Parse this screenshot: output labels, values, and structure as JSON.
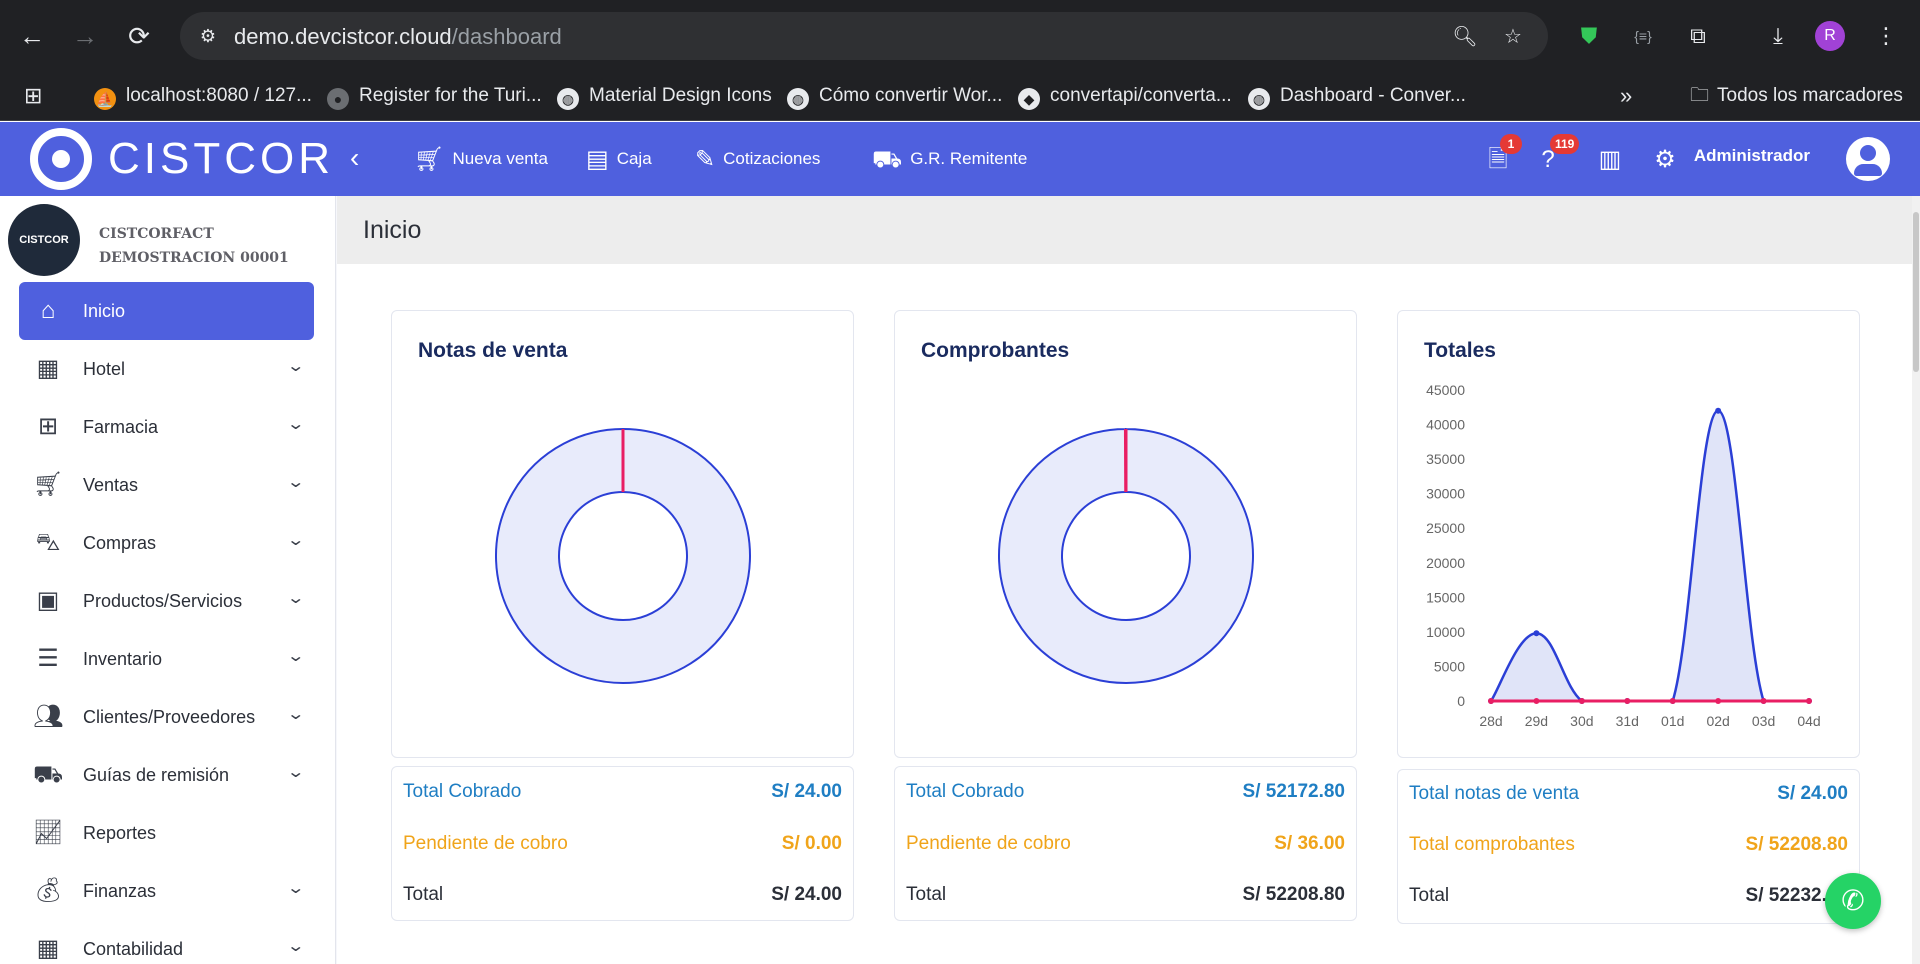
{
  "browser": {
    "url_domain": "demo.devcistcor.cloud",
    "url_path": "/dashboard",
    "profile_initial": "R",
    "bookmarks": [
      "localhost:8080 / 127...",
      "Register for the Turi...",
      "Material Design Icons",
      "Cómo convertir Wor...",
      "convertapi/converta...",
      "Dashboard - Conver..."
    ],
    "all_bookmarks_label": "Todos los marcadores"
  },
  "brand": {
    "name": "CISTCOR"
  },
  "topbar": {
    "items": [
      "Nueva venta",
      "Caja",
      "Cotizaciones",
      "G.R. Remitente"
    ],
    "badge_docs": "1",
    "badge_help": "119",
    "user_name": "Administrador"
  },
  "company": {
    "logo_text": "CISTCOR",
    "line1": "CISTCORFACT",
    "line2": "DEMOSTRACION 00001"
  },
  "sidebar": {
    "items": [
      {
        "label": "Inicio",
        "icon": "home-icon",
        "active": true,
        "expandable": false
      },
      {
        "label": "Hotel",
        "icon": "hotel-icon",
        "active": false,
        "expandable": true
      },
      {
        "label": "Farmacia",
        "icon": "pharmacy-icon",
        "active": false,
        "expandable": true
      },
      {
        "label": "Ventas",
        "icon": "cart-plus-icon",
        "active": false,
        "expandable": true
      },
      {
        "label": "Compras",
        "icon": "dolly-icon",
        "active": false,
        "expandable": true
      },
      {
        "label": "Productos/Servicios",
        "icon": "boxes-icon",
        "active": false,
        "expandable": true
      },
      {
        "label": "Inventario",
        "icon": "checklist-icon",
        "active": false,
        "expandable": true
      },
      {
        "label": "Clientes/Proveedores",
        "icon": "users-icon",
        "active": false,
        "expandable": true
      },
      {
        "label": "Guías de remisión",
        "icon": "truck-icon",
        "active": false,
        "expandable": true
      },
      {
        "label": "Reportes",
        "icon": "chart-line-icon",
        "active": false,
        "expandable": false
      },
      {
        "label": "Finanzas",
        "icon": "money-bag-icon",
        "active": false,
        "expandable": true
      },
      {
        "label": "Contabilidad",
        "icon": "calculator-icon",
        "active": false,
        "expandable": true
      }
    ]
  },
  "page": {
    "title": "Inicio"
  },
  "cards": {
    "notas": {
      "title": "Notas de venta",
      "rows": [
        {
          "label": "Total Cobrado",
          "value": "S/ 24.00"
        },
        {
          "label": "Pendiente de cobro",
          "value": "S/ 0.00"
        },
        {
          "label": "Total",
          "value": "S/ 24.00"
        }
      ]
    },
    "comprobantes": {
      "title": "Comprobantes",
      "rows": [
        {
          "label": "Total Cobrado",
          "value": "S/ 52172.80"
        },
        {
          "label": "Pendiente de cobro",
          "value": "S/ 36.00"
        },
        {
          "label": "Total",
          "value": "S/ 52208.80"
        }
      ]
    },
    "totales": {
      "title": "Totales",
      "rows": [
        {
          "label": "Total notas de venta",
          "value": "S/ 24.00"
        },
        {
          "label": "Total comprobantes",
          "value": "S/ 52208.80"
        },
        {
          "label": "Total",
          "value": "S/ 52232.80"
        }
      ]
    }
  },
  "chart_data": [
    {
      "type": "pie",
      "variant": "doughnut",
      "labels": [
        "Total Cobrado",
        "Pendiente de cobro"
      ],
      "values": [
        24.0,
        0.0
      ],
      "colors": [
        "#e8ebfb",
        "#e91e63"
      ],
      "border": "#2b3fd6"
    },
    {
      "type": "pie",
      "variant": "doughnut",
      "labels": [
        "Total Cobrado",
        "Pendiente de cobro"
      ],
      "values": [
        52172.8,
        36.0
      ],
      "colors": [
        "#e8ebfb",
        "#e91e63"
      ],
      "border": "#2b3fd6"
    },
    {
      "type": "area",
      "x": [
        "28d",
        "29d",
        "30d",
        "31d",
        "01d",
        "02d",
        "03d",
        "04d"
      ],
      "series": [
        {
          "values": [
            0,
            9800,
            0,
            0,
            0,
            42000,
            0,
            0
          ],
          "color": "#2b3fd6",
          "fill": "#e0e4f8"
        },
        {
          "values": [
            0,
            0,
            0,
            0,
            0,
            0,
            0,
            0
          ],
          "color": "#e91e63"
        }
      ],
      "yticks": [
        0,
        5000,
        10000,
        15000,
        20000,
        25000,
        30000,
        35000,
        40000,
        45000
      ],
      "ylim": [
        0,
        45000
      ]
    }
  ]
}
